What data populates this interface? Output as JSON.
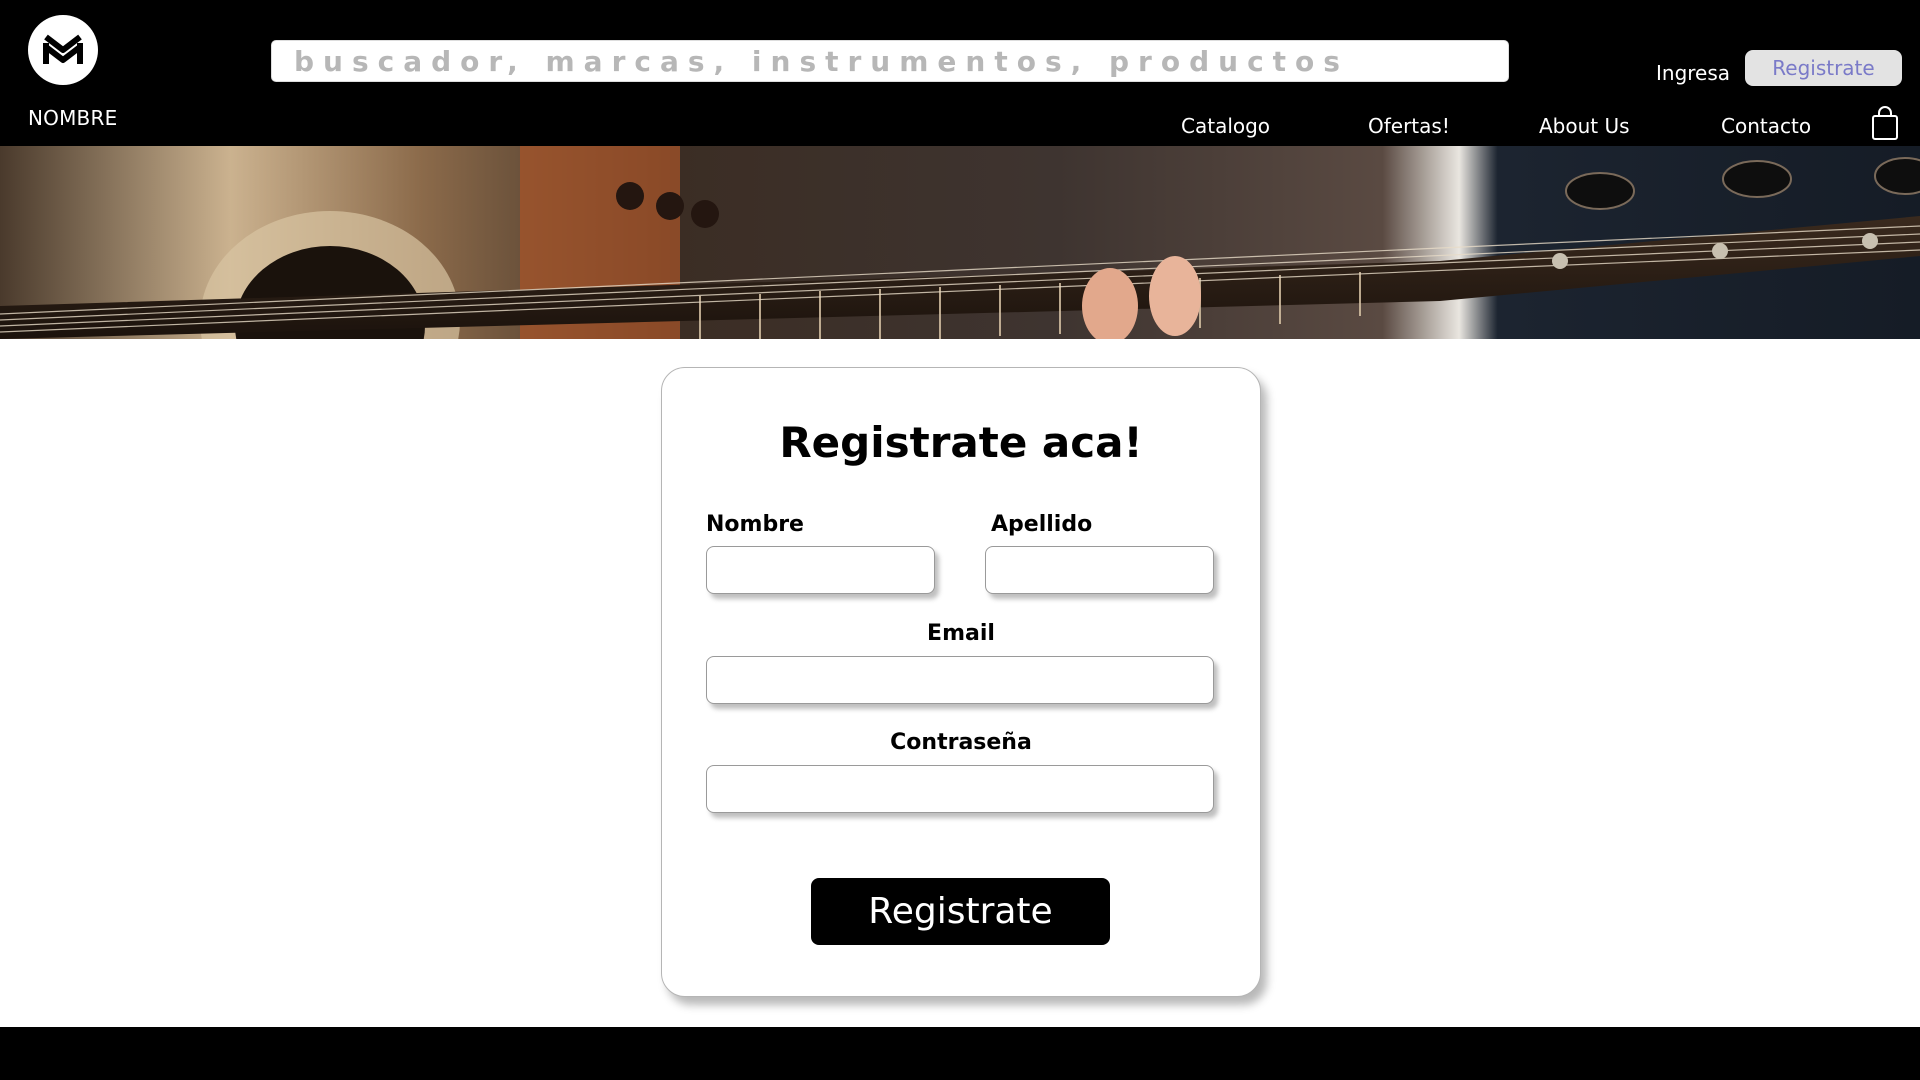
{
  "header": {
    "brand_name": "NOMBRE",
    "search": {
      "placeholder": "buscador, marcas, instrumentos, productos",
      "value": ""
    },
    "login_label": "Ingresa",
    "register_label": "Registrate",
    "nav": [
      {
        "label": "Catalogo"
      },
      {
        "label": "Ofertas!"
      },
      {
        "label": "About Us"
      },
      {
        "label": "Contacto"
      }
    ],
    "icons": {
      "logo": "mm-logo-icon",
      "cart": "shopping-bag-icon"
    }
  },
  "banner": {
    "image": "guitar-fretboard-photo"
  },
  "form": {
    "title": "Registrate aca!",
    "fields": {
      "nombre": {
        "label": "Nombre",
        "value": ""
      },
      "apellido": {
        "label": "Apellido",
        "value": ""
      },
      "email": {
        "label": "Email",
        "value": ""
      },
      "password": {
        "label": "Contraseña",
        "value": ""
      }
    },
    "submit_label": "Registrate"
  },
  "colors": {
    "header_bg": "#000000",
    "accent_register": "#7a7ac8",
    "register_bg": "#e3e3e3",
    "button_bg": "#000000"
  }
}
